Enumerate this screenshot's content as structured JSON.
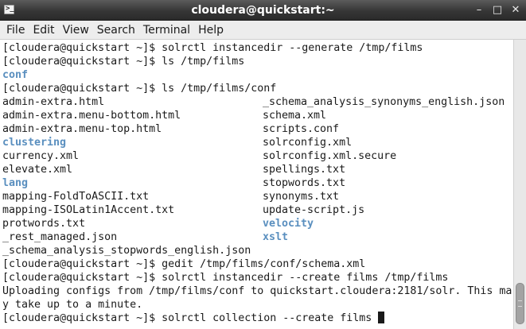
{
  "window": {
    "title": "cloudera@quickstart:~",
    "app_icon": "terminal-icon",
    "controls": [
      {
        "name": "minimize-button",
        "glyph": "–"
      },
      {
        "name": "maximize-button",
        "glyph": "□"
      },
      {
        "name": "close-button",
        "glyph": "✕"
      }
    ]
  },
  "menubar": {
    "items": [
      "File",
      "Edit",
      "View",
      "Search",
      "Terminal",
      "Help"
    ]
  },
  "colors": {
    "directory": "#5a8fbf",
    "text": "#1a1a1a",
    "background": "#ffffff",
    "titlebar": "#363636"
  },
  "terminal": {
    "lines": [
      {
        "text": "[cloudera@quickstart ~]$ solrctl instancedir --generate /tmp/films"
      },
      {
        "text": "[cloudera@quickstart ~]$ ls /tmp/films"
      },
      {
        "text": "conf",
        "dir": true
      },
      {
        "text": "[cloudera@quickstart ~]$ ls /tmp/films/conf"
      },
      {
        "c1": "admin-extra.html",
        "c2": "_schema_analysis_synonyms_english.json"
      },
      {
        "c1": "admin-extra.menu-bottom.html",
        "c2": "schema.xml"
      },
      {
        "c1": "admin-extra.menu-top.html",
        "c2": "scripts.conf"
      },
      {
        "c1": "clustering",
        "c1dir": true,
        "c2": "solrconfig.xml"
      },
      {
        "c1": "currency.xml",
        "c2": "solrconfig.xml.secure"
      },
      {
        "c1": "elevate.xml",
        "c2": "spellings.txt"
      },
      {
        "c1": "lang",
        "c1dir": true,
        "c2": "stopwords.txt"
      },
      {
        "c1": "mapping-FoldToASCII.txt",
        "c2": "synonyms.txt"
      },
      {
        "c1": "mapping-ISOLatin1Accent.txt",
        "c2": "update-script.js"
      },
      {
        "c1": "protwords.txt",
        "c2": "velocity",
        "c2dir": true
      },
      {
        "c1": "_rest_managed.json",
        "c2": "xslt",
        "c2dir": true
      },
      {
        "text": "_schema_analysis_stopwords_english.json"
      },
      {
        "text": "[cloudera@quickstart ~]$ gedit /tmp/films/conf/schema.xml"
      },
      {
        "text": "[cloudera@quickstart ~]$ solrctl instancedir --create films /tmp/films"
      },
      {
        "text": "Uploading configs from /tmp/films/conf to quickstart.cloudera:2181/solr. This ma"
      },
      {
        "text": "y take up to a minute."
      },
      {
        "text": "[cloudera@quickstart ~]$ solrctl collection --create films",
        "cursor": true
      }
    ]
  }
}
